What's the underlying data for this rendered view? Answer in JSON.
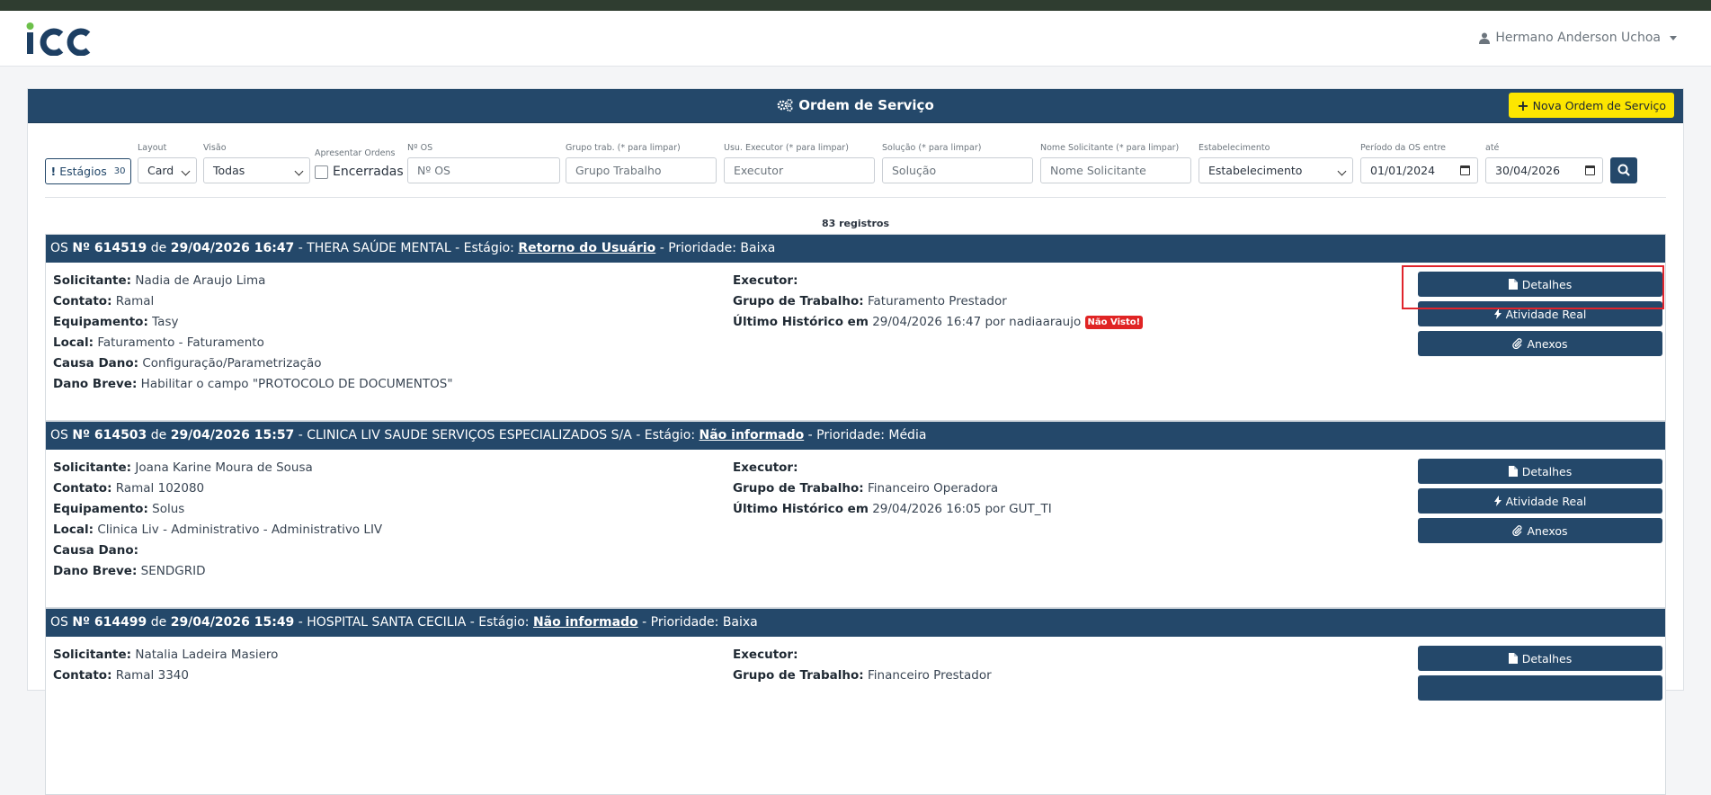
{
  "app": {
    "logo_text": "icc"
  },
  "user": {
    "name": "Hermano Anderson Uchoa"
  },
  "panel": {
    "title": "Ordem de Serviço",
    "new_button": "Nova Ordem de Serviço"
  },
  "filters": {
    "estagios_label": "Estágios",
    "estagios_count": "30",
    "layout": {
      "label": "Layout",
      "value": "Card"
    },
    "visao": {
      "label": "Visão",
      "value": "Todas"
    },
    "apresentar": {
      "label": "Apresentar Ordens",
      "checkbox_label": "Encerradas"
    },
    "numero_os": {
      "label": "Nº OS",
      "placeholder": "Nº OS"
    },
    "grupo": {
      "label": "Grupo trab. (* para limpar)",
      "placeholder": "Grupo Trabalho"
    },
    "executor": {
      "label": "Usu. Executor (* para limpar)",
      "placeholder": "Executor"
    },
    "solucao": {
      "label": "Solução (* para limpar)",
      "placeholder": "Solução"
    },
    "solicitante": {
      "label": "Nome Solicitante (* para limpar)",
      "placeholder": "Nome Solicitante"
    },
    "estabelecimento": {
      "label": "Estabelecimento",
      "value": "Estabelecimento"
    },
    "periodo": {
      "label": "Período da OS entre",
      "value": "01/01/2024"
    },
    "ate": {
      "label": "até",
      "value": "30/04/2026"
    }
  },
  "records_count": "83 registros",
  "labels": {
    "os": "OS",
    "de": "de",
    "estagio": "- Estágio:",
    "solicitante": "Solicitante:",
    "contato": "Contato:",
    "equipamento": "Equipamento:",
    "local": "Local:",
    "causa": "Causa Dano:",
    "dano": "Dano Breve:",
    "executor": "Executor:",
    "grupo": "Grupo de Trabalho:",
    "historico": "Último Histórico em",
    "detalhes": "Detalhes",
    "atividade": "Atividade Real",
    "anexos": "Anexos"
  },
  "orders": [
    {
      "number": "Nº 614519",
      "datetime": "29/04/2026 16:47",
      "client": "- THERA SAÚDE MENTAL",
      "stage": "Retorno do Usuário",
      "priority": "- Prioridade: Baixa",
      "solicitante": "Nadia de Araujo Lima",
      "contato": "Ramal",
      "equipamento": "Tasy",
      "local": "Faturamento - Faturamento",
      "causa": "Configuração/Parametrização",
      "dano": "Habilitar o campo \"PROTOCOLO DE DOCUMENTOS\"",
      "executor": "",
      "grupo": "Faturamento Prestador",
      "historico": "29/04/2026 16:47 por nadiaaraujo",
      "badge": "Não Visto!"
    },
    {
      "number": "Nº 614503",
      "datetime": "29/04/2026 15:57",
      "client": "- CLINICA LIV SAUDE SERVIÇOS ESPECIALIZADOS S/A",
      "stage": "Não informado",
      "priority": "- Prioridade: Média",
      "solicitante": "Joana Karine Moura de Sousa",
      "contato": "Ramal 102080",
      "equipamento": "Solus",
      "local": "Clinica Liv - Administrativo - Administrativo LIV",
      "causa": "",
      "dano": "SENDGRID",
      "executor": "",
      "grupo": "Financeiro Operadora",
      "historico": "29/04/2026 16:05 por GUT_TI"
    },
    {
      "number": "Nº 614499",
      "datetime": "29/04/2026 15:49",
      "client": "- HOSPITAL SANTA CECILIA",
      "stage": "Não informado",
      "priority": "- Prioridade: Baixa",
      "solicitante": "Natalia Ladeira Masiero",
      "contato": "Ramal 3340",
      "executor": "",
      "grupo": "Financeiro Prestador"
    }
  ],
  "colors": {
    "primary": "#24486a",
    "accent": "#fde600",
    "danger": "#e02424"
  }
}
